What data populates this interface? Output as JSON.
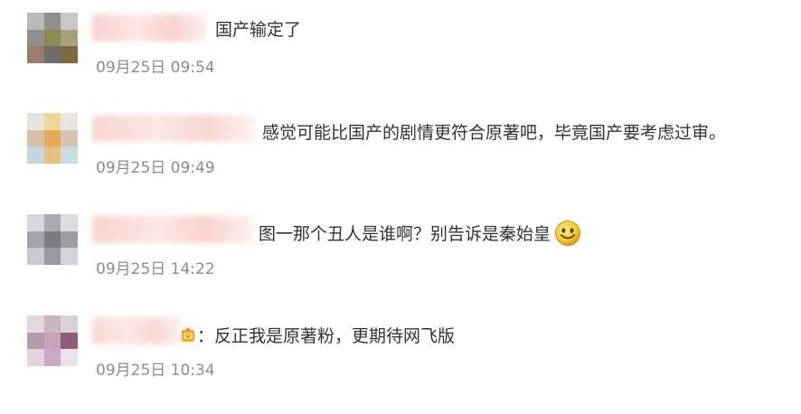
{
  "comments": [
    {
      "text": "国产输定了",
      "time": "09月25日 09:54",
      "avatar_colors": [
        "#b9b9b9",
        "#8f8f8f",
        "#c8c8c8",
        "#8f8f8f",
        "#8f8a52",
        "#a8a07a",
        "#9a7c6e",
        "#6d6d6d",
        "#7e6a3f"
      ],
      "name_blur_color": "#f6c9c3"
    },
    {
      "text": "感觉可能比国产的剧情更符合原著吧，毕竟国产要考虑过审。",
      "time": "09月25日 09:49",
      "avatar_colors": [
        "#e7e3da",
        "#f1d39c",
        "#e9e5de",
        "#d9bfa8",
        "#e4aa55",
        "#d7c3b3",
        "#c3d7dc",
        "#e6c07e",
        "#c7dfe3"
      ],
      "name_blur_color": "#f7cfc9"
    },
    {
      "text": "图一那个丑人是谁啊？别告诉是秦始皇",
      "time": "09月25日 14:22",
      "avatar_colors": [
        "#d8d8dc",
        "#a9a9b0",
        "#dcdce0",
        "#a3a3ac",
        "#7c7c86",
        "#9d9da6",
        "#c9c9cf",
        "#9898a2",
        "#d2d2d8"
      ],
      "name_blur_color": "#f7cbc4",
      "emoji": "smile-emoji"
    },
    {
      "text": "：反正我是原著粉，更期待网飞版",
      "time": "09月25日 10:34",
      "avatar_colors": [
        "#e0d8de",
        "#c8b7c2",
        "#ddd2da",
        "#b49aae",
        "#c8a2b8",
        "#8f5d7b",
        "#e4d2e2",
        "#c9a9c6",
        "#ece2ea"
      ],
      "name_blur_color": "#f8d2cc",
      "badge": "vip-badge-icon"
    }
  ]
}
